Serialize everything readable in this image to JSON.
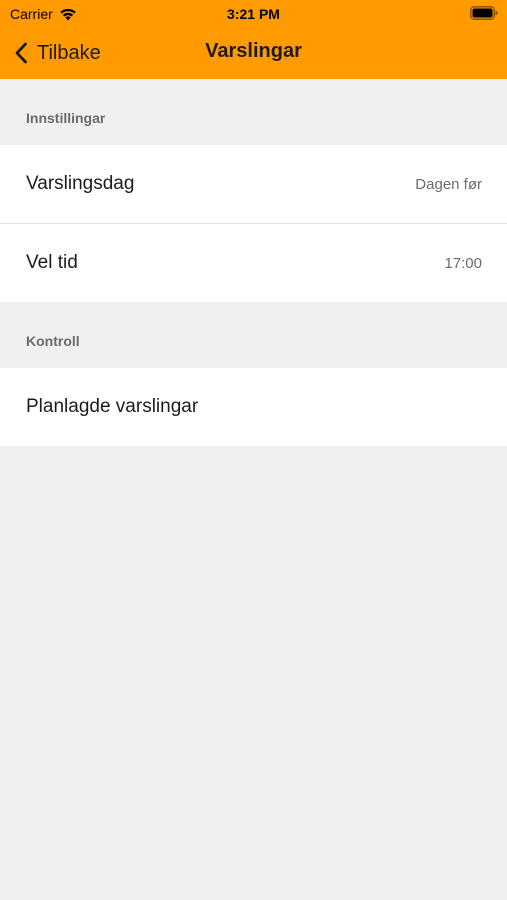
{
  "colors": {
    "accent": "#ff9a00",
    "background": "#f0f0f0",
    "cell": "#ffffff",
    "secondary_text": "#6b6b6b"
  },
  "status_bar": {
    "carrier": "Carrier",
    "time": "3:21 PM",
    "icons": [
      "wifi-icon",
      "battery-icon"
    ]
  },
  "nav": {
    "back_label": "Tilbake",
    "back_icon": "chevron-left-icon",
    "title": "Varslingar"
  },
  "sections": [
    {
      "header": "Innstillingar",
      "rows": [
        {
          "label": "Varslingsdag",
          "value": "Dagen før"
        },
        {
          "label": "Vel tid",
          "value": "17:00"
        }
      ]
    },
    {
      "header": "Kontroll",
      "rows": [
        {
          "label": "Planlagde varslingar",
          "value": ""
        }
      ]
    }
  ]
}
